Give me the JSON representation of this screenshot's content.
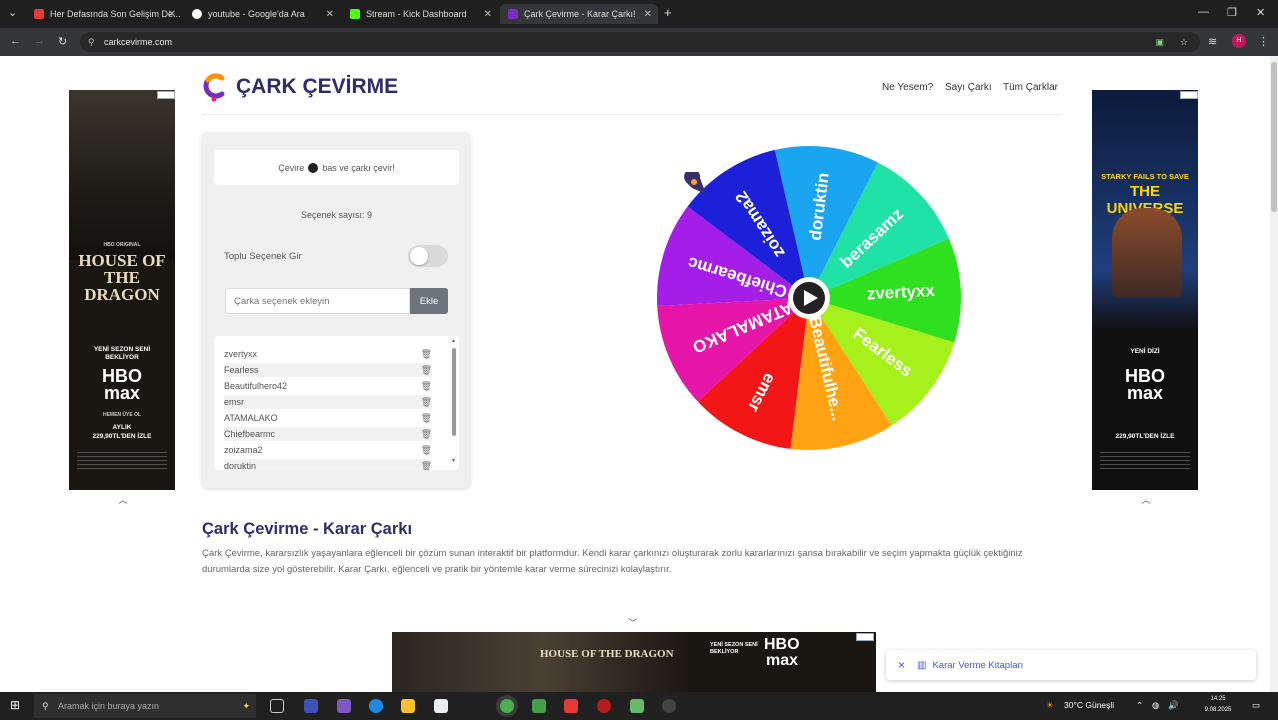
{
  "browser": {
    "tabs": [
      {
        "title": "Her Defasında Son Gelişim De...",
        "color": "#e53935",
        "active": false
      },
      {
        "title": "youtube - Google'da Ara",
        "color": "#ffffff",
        "active": false
      },
      {
        "title": "Stream - Kick Dashboard",
        "color": "#53fc18",
        "active": false
      },
      {
        "title": "Çark Çevirme - Karar Çarkı!",
        "color": "#7b2cbf",
        "active": true
      }
    ],
    "new_tab": "+",
    "url": "carkcevirme.com",
    "profile_initial": "H"
  },
  "site": {
    "brand": "ÇARK ÇEVİRME",
    "menu": [
      "Ne Yesem?",
      "Sayı Çarkı",
      "Tüm Çarklar"
    ]
  },
  "panel": {
    "hint_before": "Çevire",
    "hint_after": "bas ve çarkı çevir!",
    "count_label": "Seçenek sayısı: 9",
    "bulk_label": "Toplu Seçenek Gir",
    "input_placeholder": "Çarka seçenek ekleyin",
    "add_button": "Ekle",
    "options": [
      "zvertyxx",
      "Fearless",
      "Beautifulhero42",
      "emsr",
      "ATAMALAKO",
      "Chiefbearmc",
      "zoizama2",
      "doruktin"
    ]
  },
  "wheel": {
    "segments": [
      {
        "label": "doruktin",
        "color": "#1aa5f0"
      },
      {
        "label": "berasamz",
        "color": "#21e2a6"
      },
      {
        "label": "zvertyxx",
        "color": "#2fe01f"
      },
      {
        "label": "Fearless",
        "color": "#a6f01c"
      },
      {
        "label": "Beautifulhe...",
        "color": "#ffa313"
      },
      {
        "label": "emsr",
        "color": "#f21616"
      },
      {
        "label": "ATAMALAKO",
        "color": "#e617a8"
      },
      {
        "label": "Chiefbearmc",
        "color": "#a51ee8"
      },
      {
        "label": "zoizama2",
        "color": "#1c20d8"
      }
    ]
  },
  "content": {
    "heading": "Çark Çevirme - Karar Çarkı",
    "paragraph": "Çark Çevirme, kararsızlık yaşayanlara eğlenceli bir çözüm sunan interaktif bir platformdur. Kendi karar çarkınızı oluşturarak zorlu kararlarınızı şansa bırakabilir ve seçim yapmakta güçlük çektiğiniz durumlarda size yol gösterebilir. Karar Çarkı, eğlenceli ve pratik bir yöntemle karar verme sürecinizi kolaylaştırır."
  },
  "ads": {
    "hbo_original": "HBO ORIGINAL",
    "left_title": "HOUSE OF THE DRAGON",
    "left_tag": "YENİ SEZON SENİ BEKLİYOR",
    "hbo": "HBO",
    "max": "max",
    "left_cta": "HEMEN ÜYE OL",
    "left_price1": "AYLIK",
    "left_price2": "229,90TL'DEN İZLE",
    "right_title1": "STARKY FAILS TO SAVE",
    "right_title2": "THE UNIVERSE",
    "right_tag": "YENİ DİZİ",
    "right_price": "229,90TL'DEN İZLE",
    "bottom_tag": "YENİ SEZON SENİ BEKLİYOR"
  },
  "toast": {
    "close": "×",
    "label": "Karar Verme Kitapları"
  },
  "taskbar": {
    "search_placeholder": "Aramak için buraya yazın",
    "weather": "30°C Güneşli",
    "time": "14:25",
    "date": "9.08.2025"
  }
}
